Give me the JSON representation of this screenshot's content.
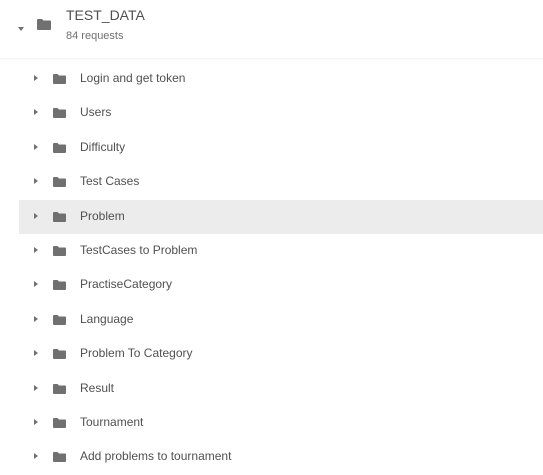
{
  "collection": {
    "name": "TEST_DATA",
    "request_count": "84 requests",
    "expanded": true
  },
  "folders": [
    {
      "label": "Login and get token",
      "selected": false
    },
    {
      "label": "Users",
      "selected": false
    },
    {
      "label": "Difficulty",
      "selected": false
    },
    {
      "label": "Test Cases",
      "selected": false
    },
    {
      "label": "Problem",
      "selected": true
    },
    {
      "label": "TestCases to Problem",
      "selected": false
    },
    {
      "label": "PractiseCategory",
      "selected": false
    },
    {
      "label": "Language",
      "selected": false
    },
    {
      "label": "Problem To Category",
      "selected": false
    },
    {
      "label": "Result",
      "selected": false
    },
    {
      "label": "Tournament",
      "selected": false
    },
    {
      "label": "Add problems to tournament",
      "selected": false
    }
  ],
  "colors": {
    "text": "#505050",
    "icon": "#707070",
    "selected_bg": "#ececec"
  },
  "icons": {
    "collapse_caret": "caret-down-icon",
    "expand_caret": "caret-right-icon",
    "folder": "folder-icon"
  }
}
